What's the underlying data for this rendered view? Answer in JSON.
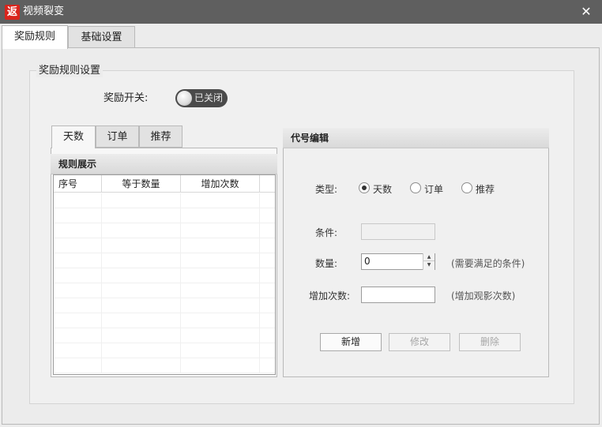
{
  "window": {
    "icon_glyph": "返",
    "title": "视频裂变",
    "close_glyph": "✕"
  },
  "main_tabs": [
    {
      "label": "奖励规则",
      "selected": true
    },
    {
      "label": "基础设置",
      "selected": false
    }
  ],
  "reward_settings": {
    "group_title": "奖励规则设置",
    "switch_label": "奖励开关:",
    "switch_state": "已关闭"
  },
  "sub_tabs": [
    {
      "label": "天数",
      "selected": true
    },
    {
      "label": "订单",
      "selected": false
    },
    {
      "label": "推荐",
      "selected": false
    }
  ],
  "rules_panel": {
    "title": "规则展示",
    "columns": [
      "序号",
      "等于数量",
      "增加次数"
    ],
    "rows": []
  },
  "edit_panel": {
    "title": "代号编辑",
    "type_label": "类型:",
    "type_options": [
      {
        "label": "天数",
        "checked": true
      },
      {
        "label": "订单",
        "checked": false
      },
      {
        "label": "推荐",
        "checked": false
      }
    ],
    "condition_label": "条件:",
    "condition_value": "",
    "quantity_label": "数量:",
    "quantity_value": "0",
    "quantity_hint": "(需要满足的条件)",
    "increase_label": "增加次数:",
    "increase_value": "",
    "increase_hint": "(增加观影次数)",
    "buttons": {
      "add": "新增",
      "modify": "修改",
      "delete": "删除"
    }
  },
  "colors": {
    "titlebar": "#5f5f5f",
    "icon_bg": "#d9241c",
    "switch_bg": "#4a4a4a"
  }
}
